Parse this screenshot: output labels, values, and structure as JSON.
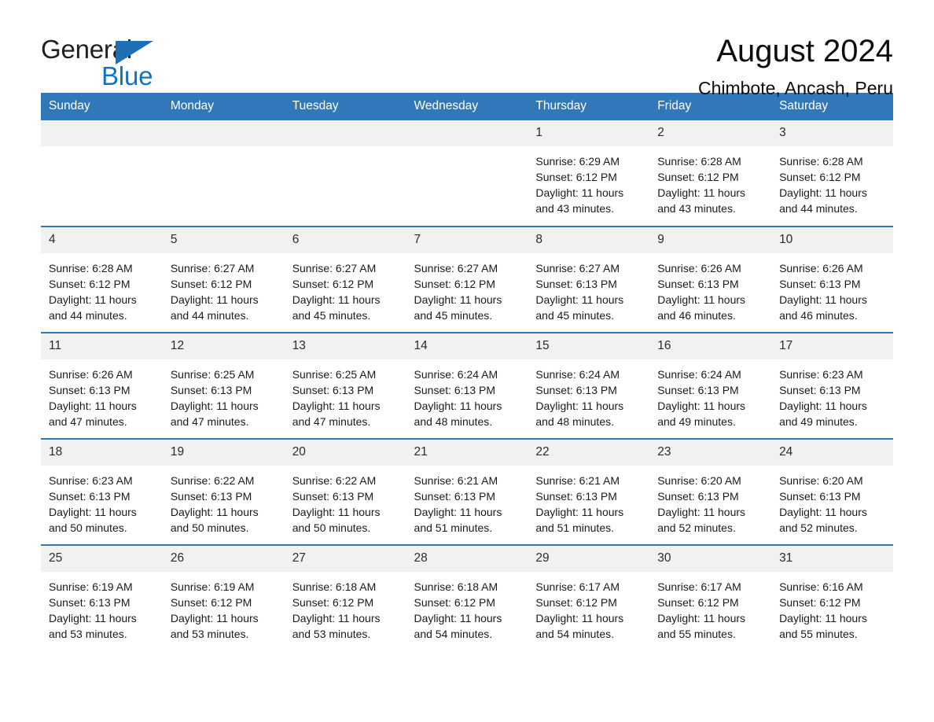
{
  "brand": {
    "name_part1": "General",
    "name_part2": "Blue",
    "logo_color": "#1273c4"
  },
  "header": {
    "title": "August 2024",
    "subtitle": "Chimbote, Ancash, Peru"
  },
  "theme": {
    "header_blue": "#3277b8",
    "daynum_background": "#f1f1f1",
    "page_background": "#ffffff"
  },
  "weekdays": [
    "Sunday",
    "Monday",
    "Tuesday",
    "Wednesday",
    "Thursday",
    "Friday",
    "Saturday"
  ],
  "weeks": [
    [
      {
        "day": "",
        "blank": true,
        "sunrise": "",
        "sunset": "",
        "daylight_line1": "",
        "daylight_line2": ""
      },
      {
        "day": "",
        "blank": true,
        "sunrise": "",
        "sunset": "",
        "daylight_line1": "",
        "daylight_line2": ""
      },
      {
        "day": "",
        "blank": true,
        "sunrise": "",
        "sunset": "",
        "daylight_line1": "",
        "daylight_line2": ""
      },
      {
        "day": "",
        "blank": true,
        "sunrise": "",
        "sunset": "",
        "daylight_line1": "",
        "daylight_line2": ""
      },
      {
        "day": "1",
        "blank": false,
        "sunrise": "Sunrise: 6:29 AM",
        "sunset": "Sunset: 6:12 PM",
        "daylight_line1": "Daylight: 11 hours",
        "daylight_line2": "and 43 minutes."
      },
      {
        "day": "2",
        "blank": false,
        "sunrise": "Sunrise: 6:28 AM",
        "sunset": "Sunset: 6:12 PM",
        "daylight_line1": "Daylight: 11 hours",
        "daylight_line2": "and 43 minutes."
      },
      {
        "day": "3",
        "blank": false,
        "sunrise": "Sunrise: 6:28 AM",
        "sunset": "Sunset: 6:12 PM",
        "daylight_line1": "Daylight: 11 hours",
        "daylight_line2": "and 44 minutes."
      }
    ],
    [
      {
        "day": "4",
        "blank": false,
        "sunrise": "Sunrise: 6:28 AM",
        "sunset": "Sunset: 6:12 PM",
        "daylight_line1": "Daylight: 11 hours",
        "daylight_line2": "and 44 minutes."
      },
      {
        "day": "5",
        "blank": false,
        "sunrise": "Sunrise: 6:27 AM",
        "sunset": "Sunset: 6:12 PM",
        "daylight_line1": "Daylight: 11 hours",
        "daylight_line2": "and 44 minutes."
      },
      {
        "day": "6",
        "blank": false,
        "sunrise": "Sunrise: 6:27 AM",
        "sunset": "Sunset: 6:12 PM",
        "daylight_line1": "Daylight: 11 hours",
        "daylight_line2": "and 45 minutes."
      },
      {
        "day": "7",
        "blank": false,
        "sunrise": "Sunrise: 6:27 AM",
        "sunset": "Sunset: 6:12 PM",
        "daylight_line1": "Daylight: 11 hours",
        "daylight_line2": "and 45 minutes."
      },
      {
        "day": "8",
        "blank": false,
        "sunrise": "Sunrise: 6:27 AM",
        "sunset": "Sunset: 6:13 PM",
        "daylight_line1": "Daylight: 11 hours",
        "daylight_line2": "and 45 minutes."
      },
      {
        "day": "9",
        "blank": false,
        "sunrise": "Sunrise: 6:26 AM",
        "sunset": "Sunset: 6:13 PM",
        "daylight_line1": "Daylight: 11 hours",
        "daylight_line2": "and 46 minutes."
      },
      {
        "day": "10",
        "blank": false,
        "sunrise": "Sunrise: 6:26 AM",
        "sunset": "Sunset: 6:13 PM",
        "daylight_line1": "Daylight: 11 hours",
        "daylight_line2": "and 46 minutes."
      }
    ],
    [
      {
        "day": "11",
        "blank": false,
        "sunrise": "Sunrise: 6:26 AM",
        "sunset": "Sunset: 6:13 PM",
        "daylight_line1": "Daylight: 11 hours",
        "daylight_line2": "and 47 minutes."
      },
      {
        "day": "12",
        "blank": false,
        "sunrise": "Sunrise: 6:25 AM",
        "sunset": "Sunset: 6:13 PM",
        "daylight_line1": "Daylight: 11 hours",
        "daylight_line2": "and 47 minutes."
      },
      {
        "day": "13",
        "blank": false,
        "sunrise": "Sunrise: 6:25 AM",
        "sunset": "Sunset: 6:13 PM",
        "daylight_line1": "Daylight: 11 hours",
        "daylight_line2": "and 47 minutes."
      },
      {
        "day": "14",
        "blank": false,
        "sunrise": "Sunrise: 6:24 AM",
        "sunset": "Sunset: 6:13 PM",
        "daylight_line1": "Daylight: 11 hours",
        "daylight_line2": "and 48 minutes."
      },
      {
        "day": "15",
        "blank": false,
        "sunrise": "Sunrise: 6:24 AM",
        "sunset": "Sunset: 6:13 PM",
        "daylight_line1": "Daylight: 11 hours",
        "daylight_line2": "and 48 minutes."
      },
      {
        "day": "16",
        "blank": false,
        "sunrise": "Sunrise: 6:24 AM",
        "sunset": "Sunset: 6:13 PM",
        "daylight_line1": "Daylight: 11 hours",
        "daylight_line2": "and 49 minutes."
      },
      {
        "day": "17",
        "blank": false,
        "sunrise": "Sunrise: 6:23 AM",
        "sunset": "Sunset: 6:13 PM",
        "daylight_line1": "Daylight: 11 hours",
        "daylight_line2": "and 49 minutes."
      }
    ],
    [
      {
        "day": "18",
        "blank": false,
        "sunrise": "Sunrise: 6:23 AM",
        "sunset": "Sunset: 6:13 PM",
        "daylight_line1": "Daylight: 11 hours",
        "daylight_line2": "and 50 minutes."
      },
      {
        "day": "19",
        "blank": false,
        "sunrise": "Sunrise: 6:22 AM",
        "sunset": "Sunset: 6:13 PM",
        "daylight_line1": "Daylight: 11 hours",
        "daylight_line2": "and 50 minutes."
      },
      {
        "day": "20",
        "blank": false,
        "sunrise": "Sunrise: 6:22 AM",
        "sunset": "Sunset: 6:13 PM",
        "daylight_line1": "Daylight: 11 hours",
        "daylight_line2": "and 50 minutes."
      },
      {
        "day": "21",
        "blank": false,
        "sunrise": "Sunrise: 6:21 AM",
        "sunset": "Sunset: 6:13 PM",
        "daylight_line1": "Daylight: 11 hours",
        "daylight_line2": "and 51 minutes."
      },
      {
        "day": "22",
        "blank": false,
        "sunrise": "Sunrise: 6:21 AM",
        "sunset": "Sunset: 6:13 PM",
        "daylight_line1": "Daylight: 11 hours",
        "daylight_line2": "and 51 minutes."
      },
      {
        "day": "23",
        "blank": false,
        "sunrise": "Sunrise: 6:20 AM",
        "sunset": "Sunset: 6:13 PM",
        "daylight_line1": "Daylight: 11 hours",
        "daylight_line2": "and 52 minutes."
      },
      {
        "day": "24",
        "blank": false,
        "sunrise": "Sunrise: 6:20 AM",
        "sunset": "Sunset: 6:13 PM",
        "daylight_line1": "Daylight: 11 hours",
        "daylight_line2": "and 52 minutes."
      }
    ],
    [
      {
        "day": "25",
        "blank": false,
        "sunrise": "Sunrise: 6:19 AM",
        "sunset": "Sunset: 6:13 PM",
        "daylight_line1": "Daylight: 11 hours",
        "daylight_line2": "and 53 minutes."
      },
      {
        "day": "26",
        "blank": false,
        "sunrise": "Sunrise: 6:19 AM",
        "sunset": "Sunset: 6:12 PM",
        "daylight_line1": "Daylight: 11 hours",
        "daylight_line2": "and 53 minutes."
      },
      {
        "day": "27",
        "blank": false,
        "sunrise": "Sunrise: 6:18 AM",
        "sunset": "Sunset: 6:12 PM",
        "daylight_line1": "Daylight: 11 hours",
        "daylight_line2": "and 53 minutes."
      },
      {
        "day": "28",
        "blank": false,
        "sunrise": "Sunrise: 6:18 AM",
        "sunset": "Sunset: 6:12 PM",
        "daylight_line1": "Daylight: 11 hours",
        "daylight_line2": "and 54 minutes."
      },
      {
        "day": "29",
        "blank": false,
        "sunrise": "Sunrise: 6:17 AM",
        "sunset": "Sunset: 6:12 PM",
        "daylight_line1": "Daylight: 11 hours",
        "daylight_line2": "and 54 minutes."
      },
      {
        "day": "30",
        "blank": false,
        "sunrise": "Sunrise: 6:17 AM",
        "sunset": "Sunset: 6:12 PM",
        "daylight_line1": "Daylight: 11 hours",
        "daylight_line2": "and 55 minutes."
      },
      {
        "day": "31",
        "blank": false,
        "sunrise": "Sunrise: 6:16 AM",
        "sunset": "Sunset: 6:12 PM",
        "daylight_line1": "Daylight: 11 hours",
        "daylight_line2": "and 55 minutes."
      }
    ]
  ]
}
